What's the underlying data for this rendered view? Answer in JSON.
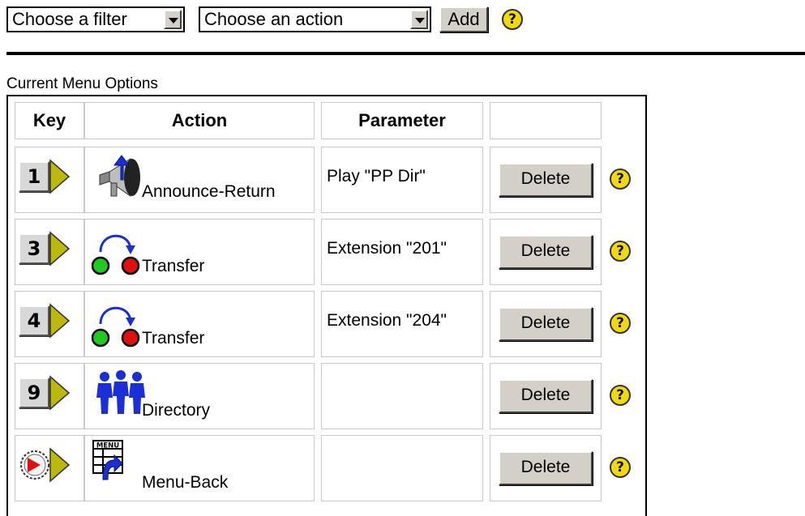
{
  "toolbar": {
    "filter_select": "Choose a filter",
    "action_select": "Choose an action",
    "add_label": "Add",
    "help_glyph": "?"
  },
  "section_title": "Current Menu Options",
  "table": {
    "headers": [
      "Key",
      "Action",
      "Parameter",
      ""
    ],
    "rows": [
      {
        "key": "1",
        "key_icon": "key-1-icon",
        "action_icon": "announce-return-icon",
        "action": "Announce-Return",
        "parameter": "Play \"PP Dir\"",
        "delete_label": "Delete"
      },
      {
        "key": "3",
        "key_icon": "key-3-icon",
        "action_icon": "transfer-icon",
        "action": "Transfer",
        "parameter": "Extension \"201\"",
        "delete_label": "Delete"
      },
      {
        "key": "4",
        "key_icon": "key-4-icon",
        "action_icon": "transfer-icon",
        "action": "Transfer",
        "parameter": "Extension \"204\"",
        "delete_label": "Delete"
      },
      {
        "key": "9",
        "key_icon": "key-9-icon",
        "action_icon": "directory-icon",
        "action": "Directory",
        "parameter": "",
        "delete_label": "Delete"
      },
      {
        "key": "",
        "key_icon": "timeout-key-icon",
        "action_icon": "menu-back-icon",
        "action": "Menu-Back",
        "parameter": "",
        "delete_label": "Delete",
        "icon_text": "MENU"
      }
    ]
  },
  "colors": {
    "help_yellow": "#f2d90e",
    "key_arrow": "#bdb80e",
    "button_face": "#d4d0c8",
    "transfer_green": "#1ecb1e",
    "transfer_red": "#e01010",
    "icon_blue": "#1a2fd6"
  }
}
